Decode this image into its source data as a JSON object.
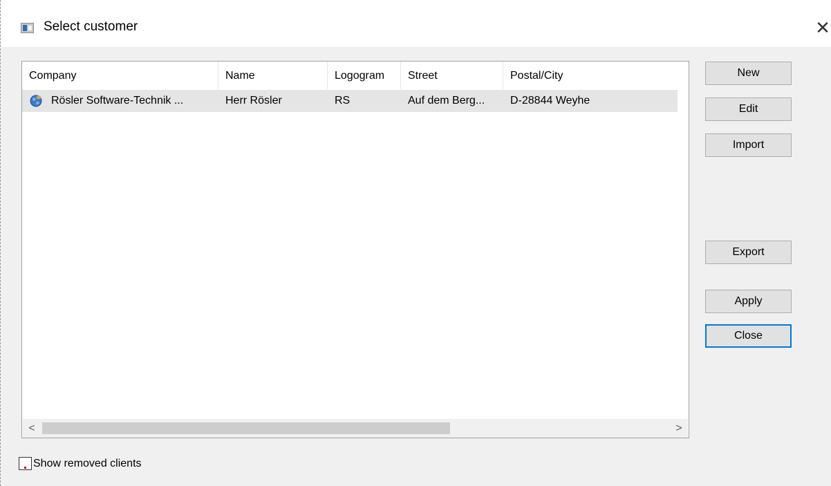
{
  "window": {
    "title": "Select customer",
    "close_symbol": "✕"
  },
  "list": {
    "columns": [
      "Company",
      "Name",
      "Logogram",
      "Street",
      "Postal/City"
    ],
    "rows": [
      {
        "icon": "customer-globe-icon",
        "company": "Rösler Software-Technik ...",
        "name": "Herr Rösler",
        "logogram": "RS",
        "street": "Auf dem Berg...",
        "postal_city": "D-28844  Weyhe"
      }
    ],
    "scroll_left": "<",
    "scroll_right": ">"
  },
  "buttons": {
    "new": "New",
    "edit": "Edit",
    "import": "Import",
    "export": "Export",
    "apply": "Apply",
    "close": "Close"
  },
  "options": {
    "show_removed_label": "Show removed clients",
    "show_removed_checked": false
  },
  "colors": {
    "dialog_bg": "#f0f0f0",
    "selected_row": "#e5e5e5",
    "default_button_border": "#0078d7"
  }
}
